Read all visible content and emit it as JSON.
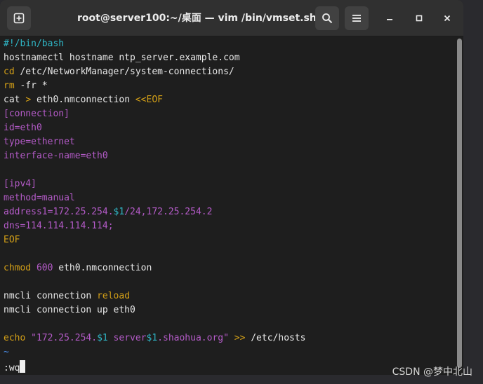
{
  "window": {
    "title": "root@server100:~/桌面 — vim /bin/vmset.sh"
  },
  "icons": {
    "new_tab": "new-tab-icon",
    "search": "search-icon",
    "menu": "hamburger-menu-icon",
    "minimize": "minimize-icon",
    "maximize": "maximize-icon",
    "close": "close-icon"
  },
  "colors": {
    "comment": "#2fb7c7",
    "keyword": "#d4a017",
    "config": "#b45bc8",
    "variable": "#2fb7c7"
  },
  "editor": {
    "lines": [
      [
        {
          "t": "#!/bin/bash",
          "c": "cyan"
        }
      ],
      [
        {
          "t": "hostnamectl hostname ntp_server.example.com",
          "c": "white"
        }
      ],
      [
        {
          "t": "cd",
          "c": "yellow"
        },
        {
          "t": " /etc/NetworkManager/system-connections/",
          "c": "white"
        }
      ],
      [
        {
          "t": "rm",
          "c": "yellow"
        },
        {
          "t": " -fr *",
          "c": "white"
        }
      ],
      [
        {
          "t": "cat ",
          "c": "white"
        },
        {
          "t": ">",
          "c": "yellow"
        },
        {
          "t": " eth0.nmconnection ",
          "c": "white"
        },
        {
          "t": "<<EOF",
          "c": "yellow"
        }
      ],
      [
        {
          "t": "[connection]",
          "c": "magenta"
        }
      ],
      [
        {
          "t": "id=eth0",
          "c": "magenta"
        }
      ],
      [
        {
          "t": "type=ethernet",
          "c": "magenta"
        }
      ],
      [
        {
          "t": "interface-name=eth0",
          "c": "magenta"
        }
      ],
      [
        {
          "t": "",
          "c": "white"
        }
      ],
      [
        {
          "t": "[ipv4]",
          "c": "magenta"
        }
      ],
      [
        {
          "t": "method=manual",
          "c": "magenta"
        }
      ],
      [
        {
          "t": "address1=172.25.254.",
          "c": "magenta"
        },
        {
          "t": "$1",
          "c": "cyan"
        },
        {
          "t": "/24,172.25.254.2",
          "c": "magenta"
        }
      ],
      [
        {
          "t": "dns=114.114.114.114;",
          "c": "magenta"
        }
      ],
      [
        {
          "t": "EOF",
          "c": "yellow"
        }
      ],
      [
        {
          "t": "",
          "c": "white"
        }
      ],
      [
        {
          "t": "chmod",
          "c": "yellow"
        },
        {
          "t": " ",
          "c": "white"
        },
        {
          "t": "600",
          "c": "magenta"
        },
        {
          "t": " eth0.nmconnection",
          "c": "white"
        }
      ],
      [
        {
          "t": "",
          "c": "white"
        }
      ],
      [
        {
          "t": "nmcli connection ",
          "c": "white"
        },
        {
          "t": "reload",
          "c": "yellow"
        }
      ],
      [
        {
          "t": "nmcli connection up eth0",
          "c": "white"
        }
      ],
      [
        {
          "t": "",
          "c": "white"
        }
      ],
      [
        {
          "t": "echo",
          "c": "yellow"
        },
        {
          "t": " ",
          "c": "white"
        },
        {
          "t": "\"172.25.254.",
          "c": "magenta"
        },
        {
          "t": "$1",
          "c": "cyan"
        },
        {
          "t": " server",
          "c": "magenta"
        },
        {
          "t": "$1",
          "c": "cyan"
        },
        {
          "t": ".shaohua.org\"",
          "c": "magenta"
        },
        {
          "t": " ",
          "c": "white"
        },
        {
          "t": ">>",
          "c": "yellow"
        },
        {
          "t": " /etc/hosts",
          "c": "white"
        }
      ],
      [
        {
          "t": "~",
          "c": "blue"
        }
      ]
    ],
    "command_line": ":wq"
  },
  "watermark": "CSDN @梦中北山"
}
